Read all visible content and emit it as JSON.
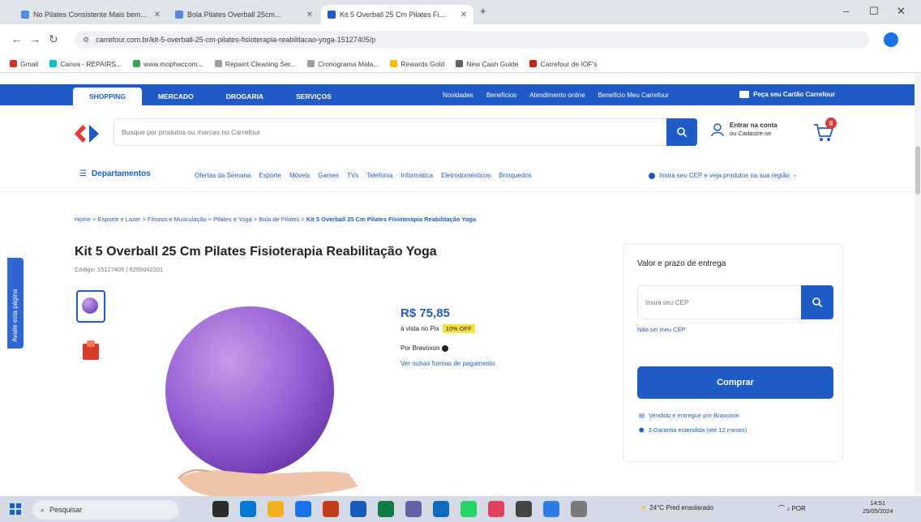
{
  "browser": {
    "tabs": [
      {
        "label": "No Pilates Consistente Mais bem..."
      },
      {
        "label": "Bola Pilates Overball 25cm..."
      },
      {
        "label": "Kit 5 Overball 25 Cm Pilates Fi..."
      }
    ],
    "url": "carrefour.com.br/kit-5-overball-25-cm-pilates-fisioterapia-reabilitacao-yoga-15127405/p",
    "bookmarks": [
      "Gmail",
      "Canva - REPAIRS...",
      "www.mophaccom...",
      "Repaint Cleaning Ser...",
      "Cronograma Mala...",
      "Rewards Gold",
      "New Cash Guide",
      "Carrefour de IOF's"
    ]
  },
  "store": {
    "top_tabs": [
      "Shopping",
      "Mercado",
      "Drogaria",
      "Serviços"
    ],
    "top_links": [
      "Novidades",
      "Benefícios",
      "Atendimento online",
      "Benefício Meu Carrefour"
    ],
    "card_link": "Peça seu Cartão Carrefour",
    "search_placeholder": "Busque por produtos ou marcas no Carrefour",
    "account_line1": "Entrar na conta",
    "account_line2": "ou Cadastre-se",
    "cart_count": "0",
    "departments_label": "Departamentos",
    "categories": [
      "Ofertas da Semana",
      "Esporte",
      "Móveis",
      "Games",
      "TVs",
      "Telefonia",
      "Informática",
      "Eletrodomésticos",
      "Brinquedos"
    ],
    "cep_prompt": "Insira seu CEP e veja produtos na sua região"
  },
  "breadcrumb": {
    "path": "Home > Esporte e Lazer > Fitness e Musculação > Pilates e Yoga > Bola de Pilates > ",
    "current": "Kit 5 Overball 25 Cm Pilates Fisioterapia Reabilitação Yoga"
  },
  "product": {
    "title": "Kit 5 Overball 25 Cm Pilates Fisioterapia Reabilitação Yoga",
    "code": "Código: 15127405 | 5295042201",
    "price": "R$ 75,85",
    "pix_text": "à vista no Pix",
    "pix_badge": "10% OFF",
    "seller_prefix": "Por Bravoxon",
    "payments_link": "Ver outras formas de pagamento"
  },
  "delivery": {
    "title": "Valor e prazo de entrega",
    "cep_placeholder": "Insira seu CEP",
    "no_cep": "Não sei meu CEP",
    "buy_button": "Comprar",
    "sold_by": "Vendido e entregue por Bravoxon",
    "guarantee": "3 Garantia estendida (até 12 meses)"
  },
  "sidetab": {
    "label": "Avalie esta página"
  },
  "taskbar": {
    "search": "Pesquisar",
    "weather": "24°C Pred ensolarado",
    "system": "POR",
    "time": "14:51",
    "date": "25/05/2024"
  },
  "colors": {
    "brand": "#1e5bc6",
    "badge": "#e53935",
    "pix": "#f5e23a"
  }
}
